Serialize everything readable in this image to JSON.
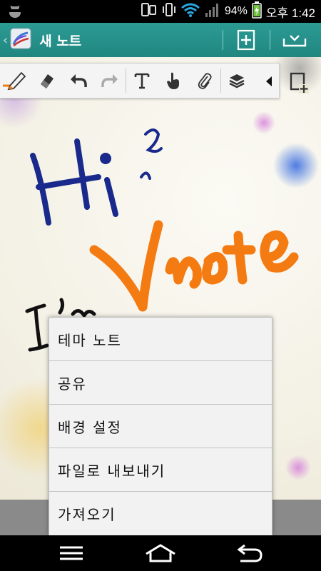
{
  "status_bar": {
    "battery_percent": "94%",
    "time": "오후 1:42",
    "icons": [
      "android-debug-icon",
      "phone-sync-icon",
      "vibrate-icon",
      "wifi-icon",
      "signal-icon",
      "battery-charging-icon"
    ]
  },
  "action_bar": {
    "title": "새 노트",
    "buttons": [
      "add-page-icon",
      "save-tray-icon"
    ]
  },
  "toolbar": {
    "tools": [
      "pen-icon",
      "eraser-icon",
      "undo-icon",
      "redo-icon",
      "text-icon",
      "hand-icon",
      "attach-icon",
      "layers-icon"
    ],
    "collapse": "collapse-arrow-icon",
    "insert": "insert-page-icon"
  },
  "drawing": {
    "strokes_text": [
      "Hi",
      "?",
      "Vnote",
      "I'm"
    ],
    "colors": {
      "blue": "#1a2a8c",
      "orange": "#f47a12",
      "black": "#111111"
    }
  },
  "menu": {
    "items": [
      "테마 노트",
      "공유",
      "배경 설정",
      "파일로 내보내기",
      "가져오기"
    ]
  },
  "nav_bar": {
    "buttons": [
      "menu-icon",
      "home-icon",
      "back-icon"
    ]
  },
  "colors": {
    "accent": "#26918a",
    "toolbar_bg": "#f4f4f4",
    "menu_bg": "#f2f2f2"
  }
}
